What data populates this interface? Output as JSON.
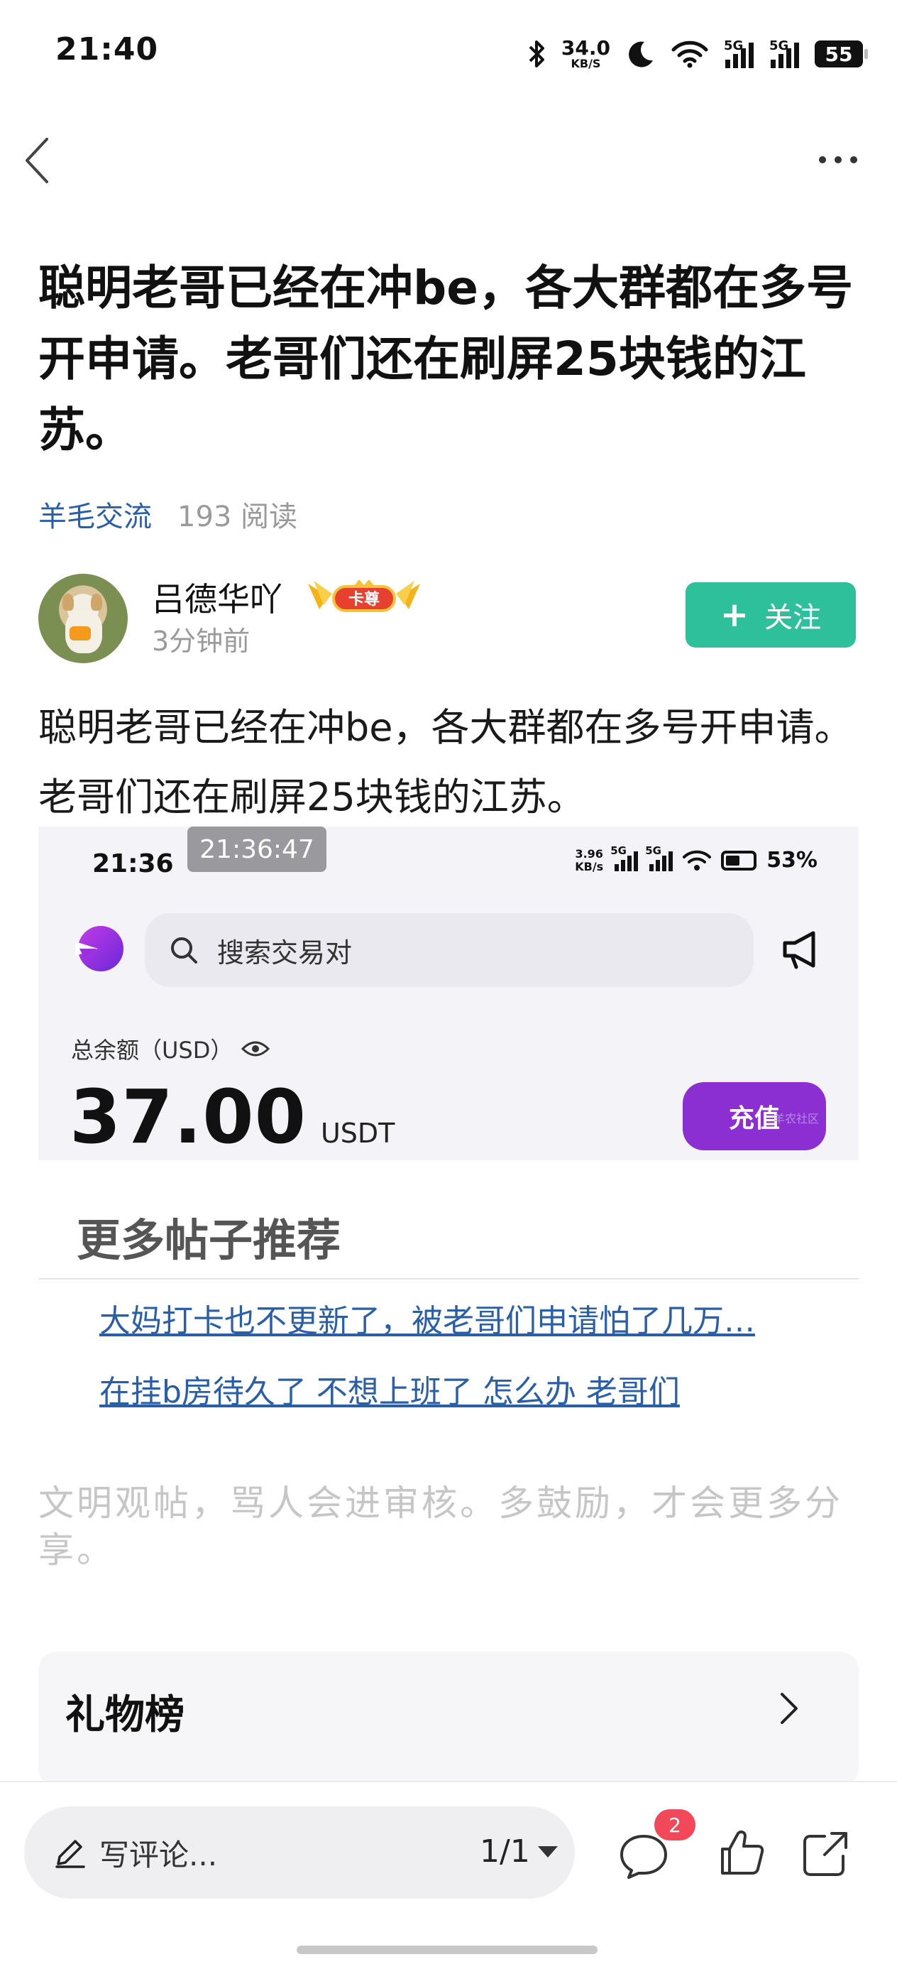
{
  "status_bar": {
    "time": "21:40",
    "net_speed": "34.0",
    "net_unit": "KB/S",
    "signal_label": "5G",
    "battery": "55"
  },
  "post": {
    "title": "聪明老哥已经在冲be，各大群都在多号开申请。老哥们还在刷屏25块钱的江苏。",
    "tag": "羊毛交流",
    "reads": "193 阅读",
    "author": "吕德华吖",
    "badge": "卡尊",
    "time": "3分钟前",
    "follow_label": "关注",
    "body": "聪明老哥已经在冲be，各大群都在多号开申请。老哥们还在刷屏25块钱的江苏。"
  },
  "embedded_screenshot": {
    "time": "21:36",
    "clock_overlay": "21:36:47",
    "net_speed": "3.96",
    "net_unit": "KB/s",
    "signal_label": "5G",
    "battery_pct": "53%",
    "search_placeholder": "搜索交易对",
    "balance_label": "总余额（USD）",
    "balance_value": "37.00",
    "balance_currency": "USDT",
    "recharge_label": "充值",
    "watermark": "羊农社区"
  },
  "more_posts": {
    "title": "更多帖子推荐",
    "items": [
      "大妈打卡也不更新了，被老哥们申请怕了几万…",
      "在挂b房待久了 不想上班了 怎么办 老哥们"
    ]
  },
  "civility_notice": "文明观帖，骂人会进审核。多鼓励，才会更多分享。",
  "gift_board": {
    "title": "礼物榜"
  },
  "bottom_bar": {
    "comment_placeholder": "写评论...",
    "page_indicator": "1/1",
    "comment_count": "2"
  },
  "colors": {
    "accent_green": "#2ebf9b",
    "link_blue": "#2a5fa8",
    "recharge_purple": "#8b2fd3",
    "badge_red": "#f2485a"
  },
  "icons": [
    "back-icon",
    "more-icon",
    "bluetooth-icon",
    "moon-icon",
    "wifi-icon",
    "search-icon",
    "megaphone-icon",
    "eye-icon",
    "chevron-right-icon",
    "pencil-icon",
    "comment-icon",
    "like-icon",
    "share-icon"
  ]
}
